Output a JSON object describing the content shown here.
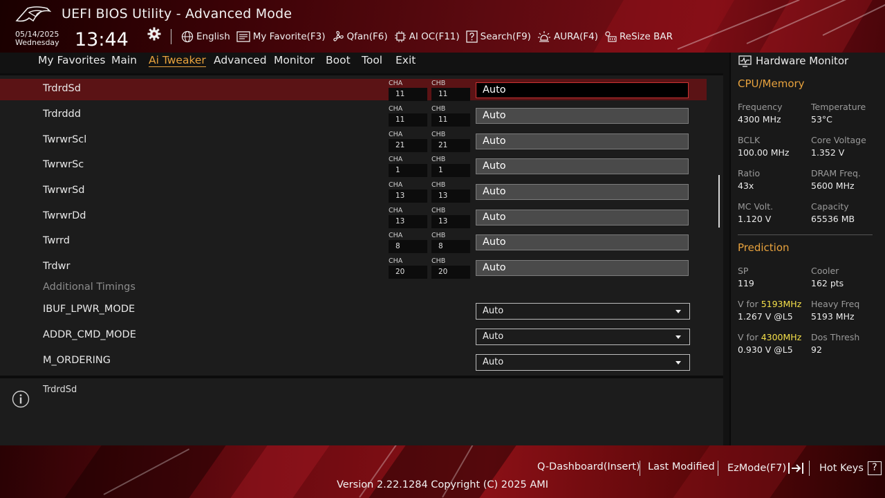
{
  "header": {
    "title": "UEFI BIOS Utility - Advanced Mode",
    "date": "05/14/2025",
    "weekday": "Wednesday",
    "time": "13:44",
    "tools": [
      {
        "icon": "globe-icon",
        "label": "English"
      },
      {
        "icon": "favorite-icon",
        "label": "My Favorite(F3)"
      },
      {
        "icon": "fan-icon",
        "label": "Qfan(F6)"
      },
      {
        "icon": "ai-chip-icon",
        "label": "AI OC(F11)"
      },
      {
        "icon": "search-help-icon",
        "label": "Search(F9)"
      },
      {
        "icon": "aura-light-icon",
        "label": "AURA(F4)"
      },
      {
        "icon": "resize-bar-icon",
        "label": "ReSize BAR"
      }
    ]
  },
  "menu": {
    "items": [
      "My Favorites",
      "Main",
      "Ai Tweaker",
      "Advanced",
      "Monitor",
      "Boot",
      "Tool",
      "Exit"
    ],
    "active": "Ai Tweaker"
  },
  "timings": {
    "cha_label": "CHA",
    "chb_label": "CHB",
    "rows": [
      {
        "name": "TrdrdSd",
        "cha": "11",
        "chb": "11",
        "value": "Auto",
        "selected": true
      },
      {
        "name": "Trdrddd",
        "cha": "11",
        "chb": "11",
        "value": "Auto"
      },
      {
        "name": "TwrwrScl",
        "cha": "21",
        "chb": "21",
        "value": "Auto"
      },
      {
        "name": "TwrwrSc",
        "cha": "1",
        "chb": "1",
        "value": "Auto"
      },
      {
        "name": "TwrwrSd",
        "cha": "13",
        "chb": "13",
        "value": "Auto"
      },
      {
        "name": "TwrwrDd",
        "cha": "13",
        "chb": "13",
        "value": "Auto"
      },
      {
        "name": "Twrrd",
        "cha": "8",
        "chb": "8",
        "value": "Auto"
      },
      {
        "name": "Trdwr",
        "cha": "20",
        "chb": "20",
        "value": "Auto"
      }
    ],
    "section_header": "Additional Timings",
    "dropdowns": [
      {
        "name": "IBUF_LPWR_MODE",
        "value": "Auto"
      },
      {
        "name": "ADDR_CMD_MODE",
        "value": "Auto"
      },
      {
        "name": "M_ORDERING",
        "value": "Auto"
      }
    ]
  },
  "help": {
    "text": "TrdrdSd"
  },
  "hardware_monitor": {
    "title": "Hardware Monitor",
    "cpu_memory": {
      "heading": "CPU/Memory",
      "items": [
        {
          "label": "Frequency",
          "value": "4300 MHz"
        },
        {
          "label": "Temperature",
          "value": "53°C"
        },
        {
          "label": "BCLK",
          "value": "100.00 MHz"
        },
        {
          "label": "Core Voltage",
          "value": "1.352 V"
        },
        {
          "label": "Ratio",
          "value": "43x"
        },
        {
          "label": "DRAM Freq.",
          "value": "5600 MHz"
        },
        {
          "label": "MC Volt.",
          "value": "1.120 V"
        },
        {
          "label": "Capacity",
          "value": "65536 MB"
        }
      ]
    },
    "prediction": {
      "heading": "Prediction",
      "sp_label": "SP",
      "sp_value": "119",
      "cooler_label": "Cooler",
      "cooler_value": "162 pts",
      "v_for_label": "V for",
      "v1_freq": "5193MHz",
      "v1_value": "1.267 V @L5",
      "heavy_label": "Heavy Freq",
      "heavy_value": "5193 MHz",
      "v2_freq": "4300MHz",
      "v2_value": "0.930 V @L5",
      "dos_label": "Dos Thresh",
      "dos_value": "92"
    }
  },
  "footer": {
    "q_dashboard": "Q-Dashboard(Insert)",
    "last_modified": "Last Modified",
    "ezmode": "EzMode(F7)",
    "hotkeys": "Hot Keys",
    "hotkeys_glyph": "?",
    "version": "Version 2.22.1284 Copyright (C) 2025 AMI"
  },
  "colors": {
    "accent": "#e8a23d",
    "highlight_freq": "#f5e04a",
    "selected_row": "#5b1315",
    "header_red": "#7a0d14"
  }
}
